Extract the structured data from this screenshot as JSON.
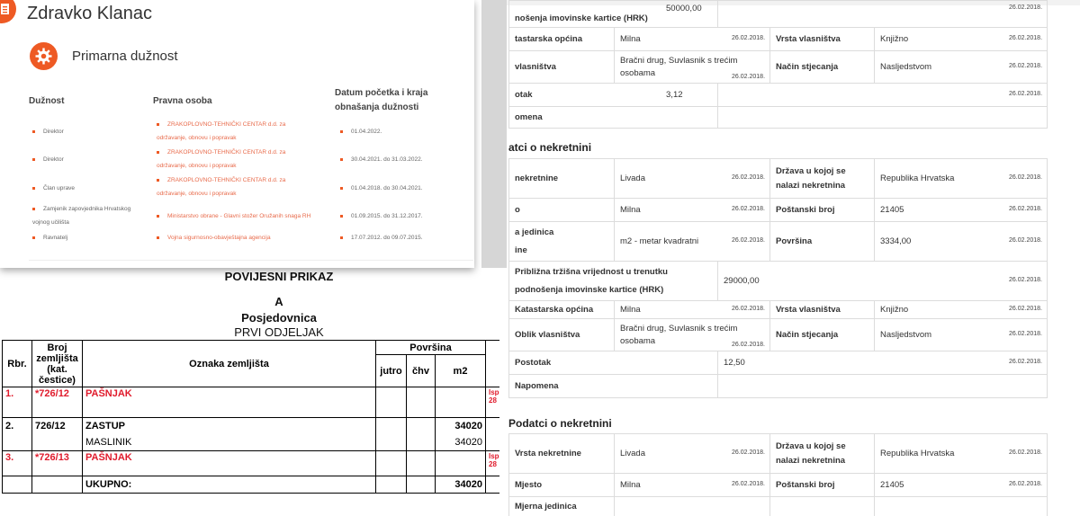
{
  "colors": {
    "accent": "#ee5a24",
    "link": "#e86a4a",
    "scan_red": "#e01b2c"
  },
  "card": {
    "name": "Zdravko Klanac",
    "section_title": "Primarna dužnost",
    "section_icon": "gear-icon",
    "headers": {
      "duty": "Dužnost",
      "org": "Pravna osoba",
      "dates": "Datum početka i kraja obnašanja dužnosti"
    },
    "rows": [
      {
        "duty": "Direktor",
        "org": [
          "ZRAKOPLOVNO-TEHNIČKI CENTAR d.d. za",
          "održavanje, obnovu i popravak"
        ],
        "dates": "01.04.2022."
      },
      {
        "duty": "Direktor",
        "org": [
          "ZRAKOPLOVNO-TEHNIČKI CENTAR d.d. za",
          "održavanje, obnovu i popravak"
        ],
        "dates": "30.04.2021. do 31.03.2022."
      },
      {
        "duty": "Član uprave",
        "org": [
          "ZRAKOPLOVNO-TEHNIČKI CENTAR d.d. za",
          "održavanje, obnovu i popravak"
        ],
        "dates": "01.04.2018. do 30.04.2021."
      },
      {
        "duty": [
          "Zamjenik zapovjednika Hrvatskog",
          "vojnog učilišta"
        ],
        "org": [
          "Ministarstvo obrane - Glavni stožer Oružanih snaga RH"
        ],
        "dates": "01.09.2015. do 31.12.2017."
      },
      {
        "duty": "Ravnatelj",
        "org": [
          "Vojna sigurnosno-obavještajna agencija"
        ],
        "dates": "17.07.2012. do 09.07.2015."
      }
    ]
  },
  "right": {
    "block0": {
      "top_value_label": "nošenja imovinske kartice (HRK)",
      "top_value": "50000,00",
      "top_date": "26.02.2018.",
      "opcina_label": "tastarska općina",
      "opcina": "Milna",
      "opcina_date": "26.02.2018.",
      "vrsta_label": "Vrsta vlasništva",
      "vrsta": "Knjižno",
      "vrsta_date": "26.02.2018.",
      "oblik_label": "vlasništva",
      "oblik": [
        "Bračni drug, Suvlasnik s trećim",
        "osobama"
      ],
      "oblik_date": "26.02.2018.",
      "nacin_label": "Način stjecanja",
      "nacin": "Nasljedstvom",
      "nacin_date": "26.02.2018.",
      "postotak_label": "otak",
      "postotak": "3,12",
      "postotak_date": "26.02.2018.",
      "napomena_label": "omena"
    },
    "section1_title": "atci o nekretnini",
    "block1": {
      "vrsta_nek_label": "nekretnine",
      "vrsta_nek": "Livada",
      "vrsta_nek_date": "26.02.2018.",
      "drzava_label": "Država u kojoj se nalazi nekretnina",
      "drzava": "Republika Hrvatska",
      "drzava_date": "26.02.2018.",
      "mjesto_label": "o",
      "mjesto": "Milna",
      "mjesto_date": "26.02.2018.",
      "postanski_label": "Poštanski broj",
      "postanski": "21405",
      "postanski_date": "26.02.2018.",
      "mjerna_label": [
        "a jedinica",
        "ine"
      ],
      "mjerna": "m2 - metar kvadratni",
      "mjerna_date": "26.02.2018.",
      "povrsina_label": "Površina",
      "povrsina": "3334,00",
      "povrsina_date": "26.02.2018.",
      "trzisna_label": [
        "Približna tržišna vrijednost u trenutku",
        "podnošenja imovinske kartice (HRK)"
      ],
      "trzisna": "29000,00",
      "trzisna_date": "26.02.2018.",
      "opcina_label": "Katastarska općina",
      "opcina": "Milna",
      "opcina_date": "26.02.2018.",
      "vrsta_label": "Vrsta vlasništva",
      "vrsta": "Knjižno",
      "vrsta_date": "26.02.2018.",
      "oblik_label": "Oblik vlasništva",
      "oblik": [
        "Bračni drug, Suvlasnik s trećim",
        "osobama"
      ],
      "oblik_date": "26.02.2018.",
      "nacin_label": "Način stjecanja",
      "nacin": "Nasljedstvom",
      "nacin_date": "26.02.2018.",
      "postotak_label": "Postotak",
      "postotak": "12,50",
      "postotak_date": "26.02.2018.",
      "napomena_label": "Napomena"
    },
    "section2_title": "Podatci o nekretnini",
    "block2": {
      "vrsta_nek_label": "Vrsta nekretnine",
      "vrsta_nek": "Livada",
      "vrsta_nek_date": "26.02.2018.",
      "drzava_label": "Država u kojoj se nalazi nekretnina",
      "drzava": "Republika Hrvatska",
      "drzava_date": "26.02.2018.",
      "mjesto_label": "Mjesto",
      "mjesto": "Milna",
      "mjesto_date": "26.02.2018.",
      "postanski_label": "Poštanski broj",
      "postanski": "21405",
      "postanski_date": "26.02.2018.",
      "mjerna_label": "Mjerna jedinica"
    }
  },
  "scan": {
    "title": "POVIJESNI PRIKAZ",
    "letter": "A",
    "subtitle": "Posjedovnica",
    "section": "PRVI ODJELJAK",
    "headers": {
      "rbr": "Rbr.",
      "broj": "Broj zemljišta (kat. čestice)",
      "oznaka": "Oznaka zemljišta",
      "povrsina": "Površina",
      "jutro": "jutro",
      "chv": "čhv",
      "m2": "m2"
    },
    "rows": [
      {
        "rbr": "1.",
        "broj": "*726/12",
        "oznaka": "PAŠNJAK",
        "m2": "",
        "note": "Isp",
        "note2": "28",
        "red": true
      },
      {
        "rbr": "2.",
        "broj": "726/12",
        "oznaka": "ZASTUP",
        "m2": "34020",
        "red": false
      },
      {
        "rbr": "",
        "broj": "",
        "oznaka": "MASLINIK",
        "m2": "34020",
        "red": false
      },
      {
        "rbr": "3.",
        "broj": "*726/13",
        "oznaka": "PAŠNJAK",
        "m2": "",
        "note": "Isp",
        "note2": "28",
        "red": true
      },
      {
        "rbr": "",
        "broj": "",
        "oznaka": "UKUPNO:",
        "m2": "34020",
        "red": false
      }
    ]
  }
}
